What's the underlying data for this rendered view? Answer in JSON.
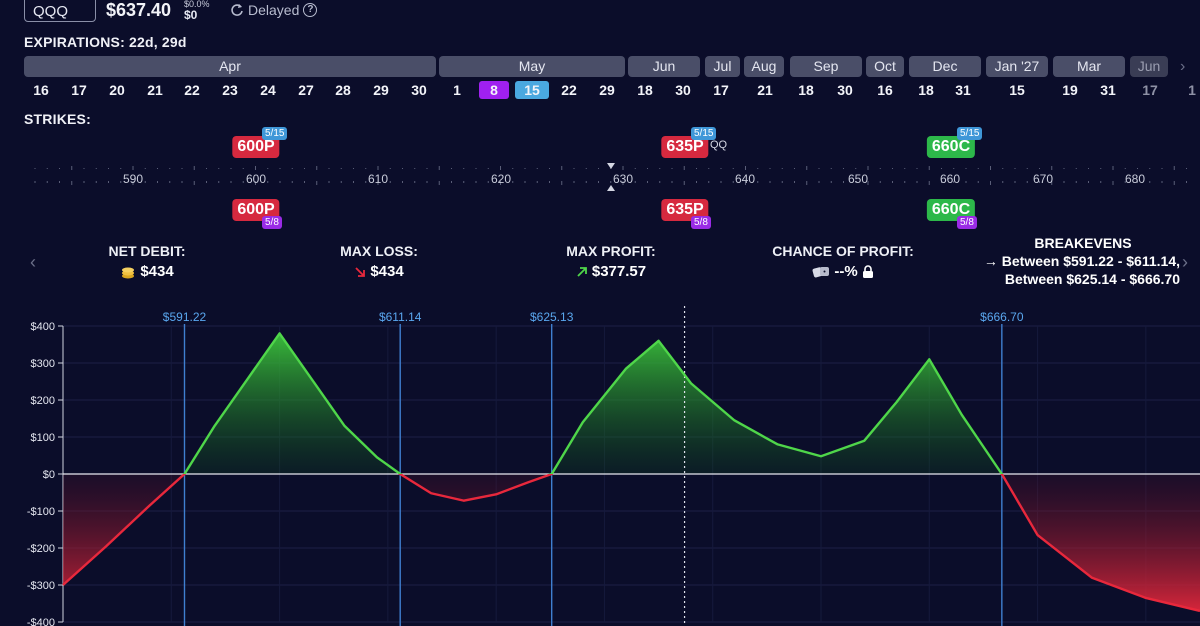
{
  "header": {
    "ticker": "QQQ",
    "price": "$637.40",
    "change_top": "$0.0%",
    "change_sub": "$0",
    "status": "Delayed",
    "status_icon": "refresh-icon",
    "info_icon": "info-icon"
  },
  "expirations": {
    "label": "EXPIRATIONS: 22d, 29d",
    "months": [
      {
        "label": "Apr",
        "dim": false
      },
      {
        "label": "May",
        "dim": false
      },
      {
        "label": "Jun",
        "dim": false
      },
      {
        "label": "Jul",
        "dim": false
      },
      {
        "label": "Aug",
        "dim": false
      },
      {
        "label": "Sep",
        "dim": false
      },
      {
        "label": "Oct",
        "dim": false
      },
      {
        "label": "Dec",
        "dim": false
      },
      {
        "label": "Jan '27",
        "dim": false
      },
      {
        "label": "Mar",
        "dim": false
      },
      {
        "label": "Jun",
        "dim": true
      }
    ],
    "days": [
      "16",
      "17",
      "20",
      "21",
      "22",
      "23",
      "24",
      "27",
      "28",
      "29",
      "30",
      "1",
      "8",
      "15",
      "22",
      "29",
      "18",
      "30",
      "17",
      "21",
      "18",
      "30",
      "16",
      "18",
      "31",
      "15",
      "19",
      "31",
      "17",
      "1"
    ],
    "selected": [
      "8",
      "15"
    ]
  },
  "strikes": {
    "label": "STRIKES:",
    "ticks": [
      "590",
      "600",
      "610",
      "620",
      "630",
      "640",
      "650",
      "660",
      "670",
      "680"
    ],
    "current_marker": "630",
    "qq_label": "QQ",
    "top_legs": [
      {
        "label": "600P",
        "color": "red",
        "badge": "5/15"
      },
      {
        "label": "635P",
        "color": "red",
        "badge": "5/15"
      },
      {
        "label": "660C",
        "color": "green",
        "badge": "5/15"
      }
    ],
    "bottom_legs": [
      {
        "label": "600P",
        "color": "red",
        "badge": "5/8"
      },
      {
        "label": "635P",
        "color": "red",
        "badge": "5/8"
      },
      {
        "label": "660C",
        "color": "green",
        "badge": "5/8"
      }
    ]
  },
  "stats": {
    "net_debit_label": "NET DEBIT:",
    "net_debit_value": "$434",
    "net_debit_icon": "coins-icon",
    "max_loss_label": "MAX LOSS:",
    "max_loss_value": "$434",
    "max_loss_icon": "arrow-down-right-icon",
    "max_profit_label": "MAX PROFIT:",
    "max_profit_value": "$377.57",
    "max_profit_icon": "arrow-up-right-icon",
    "chance_label": "CHANCE OF PROFIT:",
    "chance_value": "--%",
    "chance_icon": "dice-icon",
    "lock_icon": "lock-icon",
    "breakevens_label": "BREAKEVENS",
    "breakevens_line1": "Between $591.22 - $611.14,",
    "breakevens_line2": "Between $625.14 - $666.70"
  },
  "chart_data": {
    "type": "area",
    "title": "",
    "xlabel": "",
    "ylabel": "",
    "y_ticks": [
      "$400",
      "$300",
      "$200",
      "$100",
      "$0",
      "-$100",
      "-$200",
      "-$300",
      "-$400"
    ],
    "ylim": [
      -400,
      400
    ],
    "xlim": [
      580,
      685
    ],
    "breakeven_labels": [
      "$591.22",
      "$611.14",
      "$625.13",
      "$666.70"
    ],
    "breakeven_x": [
      591.22,
      611.14,
      625.13,
      666.7
    ],
    "current_price": 637.4,
    "grid": true,
    "colors": {
      "profit": "#4fd64a",
      "loss": "#e8283c",
      "line": "#ffffff"
    },
    "series": [
      {
        "x": [
          580,
          584,
          588,
          591.22,
          594,
          597,
          600,
          603,
          606,
          609,
          611.14,
          614,
          617,
          620,
          623,
          625.13,
          628,
          632,
          635,
          638,
          642,
          646,
          650,
          654,
          657,
          660,
          663,
          666.7,
          670,
          675,
          680,
          685
        ],
        "values": [
          -300,
          -195,
          -85,
          0,
          130,
          255,
          380,
          255,
          130,
          45,
          0,
          -52,
          -72,
          -55,
          -22,
          0,
          140,
          285,
          360,
          245,
          145,
          80,
          48,
          90,
          195,
          310,
          160,
          0,
          -165,
          -280,
          -335,
          -370
        ]
      }
    ]
  }
}
